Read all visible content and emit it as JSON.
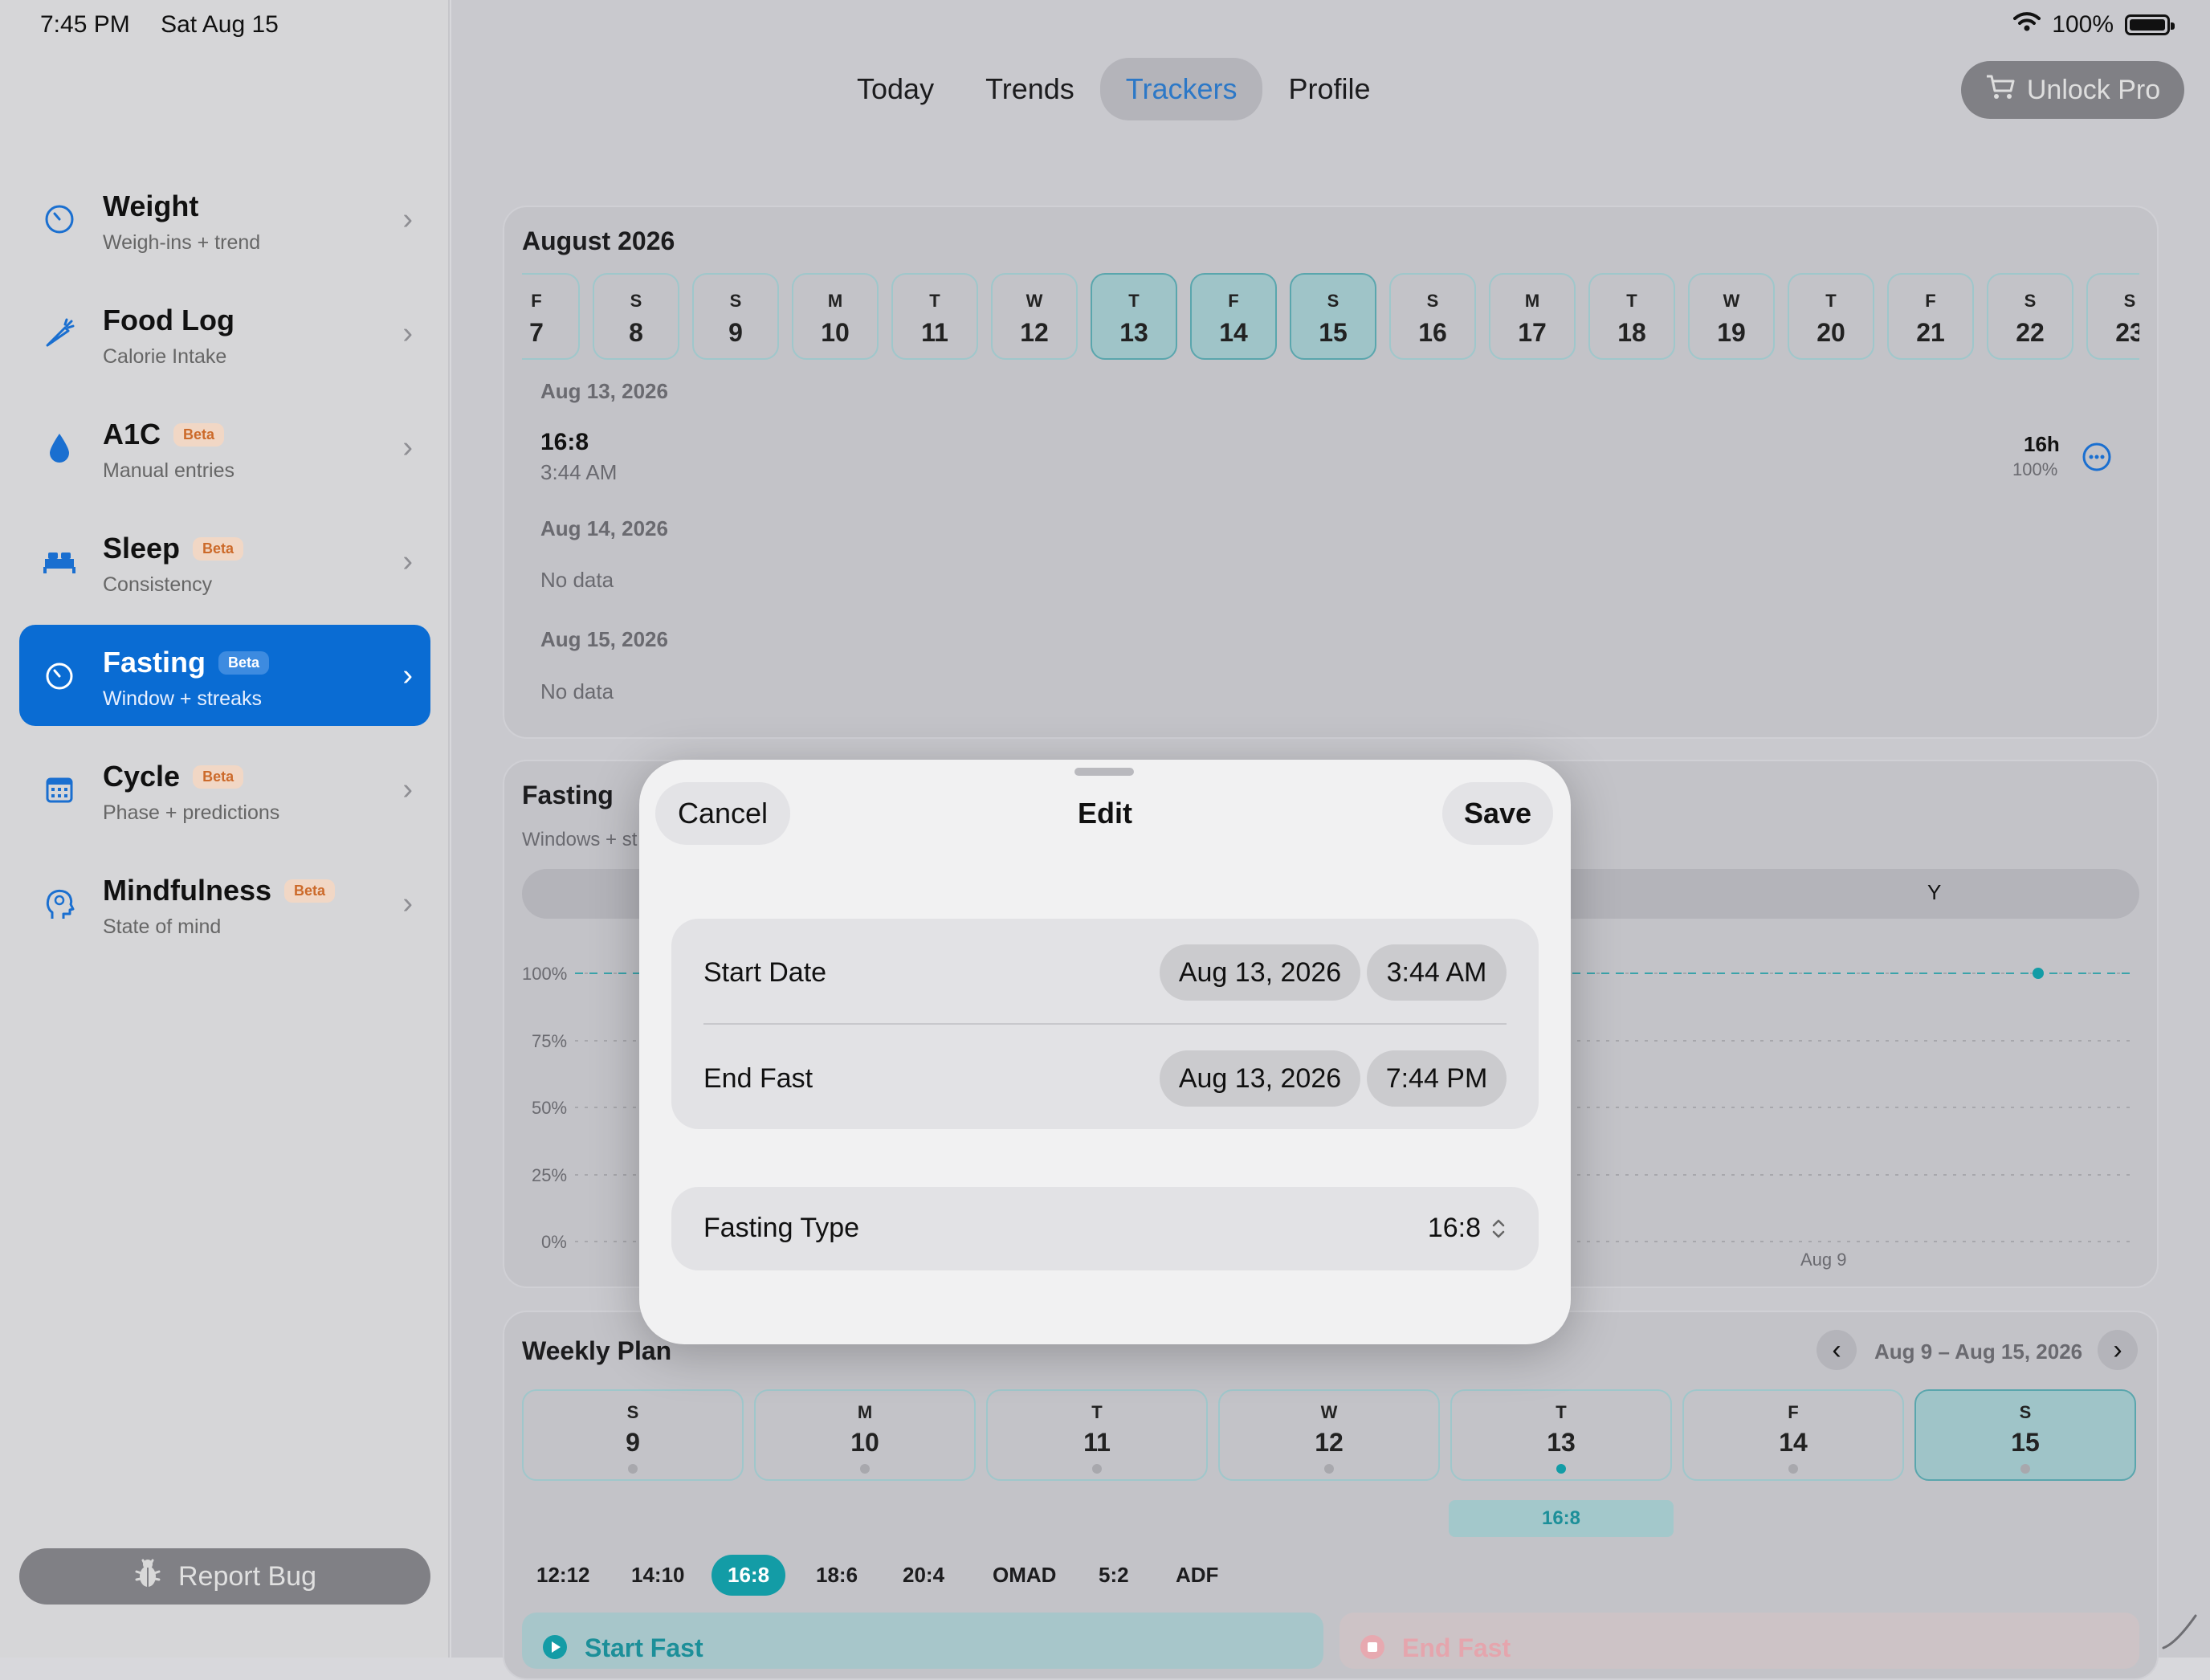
{
  "status": {
    "time": "7:45 PM",
    "date": "Sat Aug 15",
    "battery": "100%"
  },
  "sidebar": {
    "items": [
      {
        "title": "Weight",
        "sub": "Weigh-ins + trend",
        "badge": ""
      },
      {
        "title": "Food Log",
        "sub": "Calorie Intake",
        "badge": ""
      },
      {
        "title": "A1C",
        "sub": "Manual entries",
        "badge": "Beta"
      },
      {
        "title": "Sleep",
        "sub": "Consistency",
        "badge": "Beta"
      },
      {
        "title": "Fasting",
        "sub": "Window + streaks",
        "badge": "Beta"
      },
      {
        "title": "Cycle",
        "sub": "Phase + predictions",
        "badge": "Beta"
      },
      {
        "title": "Mindfulness",
        "sub": "State of mind",
        "badge": "Beta"
      }
    ],
    "report_bug": "Report Bug"
  },
  "tabs": [
    "Today",
    "Trends",
    "Trackers",
    "Profile"
  ],
  "unlock_pro": "Unlock Pro",
  "calendar": {
    "month": "August 2026",
    "days": [
      {
        "l": "F",
        "n": "7"
      },
      {
        "l": "S",
        "n": "8"
      },
      {
        "l": "S",
        "n": "9"
      },
      {
        "l": "M",
        "n": "10"
      },
      {
        "l": "T",
        "n": "11"
      },
      {
        "l": "W",
        "n": "12"
      },
      {
        "l": "T",
        "n": "13"
      },
      {
        "l": "F",
        "n": "14"
      },
      {
        "l": "S",
        "n": "15"
      },
      {
        "l": "S",
        "n": "16"
      },
      {
        "l": "M",
        "n": "17"
      },
      {
        "l": "T",
        "n": "18"
      },
      {
        "l": "W",
        "n": "19"
      },
      {
        "l": "T",
        "n": "20"
      },
      {
        "l": "F",
        "n": "21"
      },
      {
        "l": "S",
        "n": "22"
      },
      {
        "l": "S",
        "n": "23"
      }
    ],
    "entries": {
      "d1": "Aug 13, 2026",
      "d1_type": "16:8",
      "d1_time": "3:44 AM",
      "d1_hours": "16h",
      "d1_pct": "100%",
      "d2": "Aug 14, 2026",
      "d2_nodata": "No data",
      "d3": "Aug 15, 2026",
      "d3_nodata": "No data"
    }
  },
  "fasting_card": {
    "title": "Fasting",
    "sub": "Windows + st",
    "seg_y": "Y",
    "y_ticks": [
      "100%",
      "75%",
      "50%",
      "25%",
      "0%"
    ],
    "x_label": "Aug 9"
  },
  "weekly_plan": {
    "title": "Weekly Plan",
    "range": "Aug 9 – Aug 15, 2026",
    "days": [
      {
        "l": "S",
        "n": "9"
      },
      {
        "l": "M",
        "n": "10"
      },
      {
        "l": "T",
        "n": "11"
      },
      {
        "l": "W",
        "n": "12"
      },
      {
        "l": "T",
        "n": "13"
      },
      {
        "l": "F",
        "n": "14"
      },
      {
        "l": "S",
        "n": "15"
      }
    ],
    "plan_tag": "16:8",
    "chips": [
      "12:12",
      "14:10",
      "16:8",
      "18:6",
      "20:4",
      "OMAD",
      "5:2",
      "ADF"
    ],
    "start_fast": "Start Fast",
    "end_fast": "End Fast"
  },
  "modal": {
    "cancel": "Cancel",
    "title": "Edit",
    "save": "Save",
    "start_label": "Start Date",
    "start_date": "Aug 13, 2026",
    "start_time": "3:44 AM",
    "end_label": "End Fast",
    "end_date": "Aug 13, 2026",
    "end_time": "7:44 PM",
    "type_label": "Fasting Type",
    "type_value": "16:8"
  },
  "colors": {
    "accent": "#0a6cd3",
    "teal": "#139ca6"
  }
}
